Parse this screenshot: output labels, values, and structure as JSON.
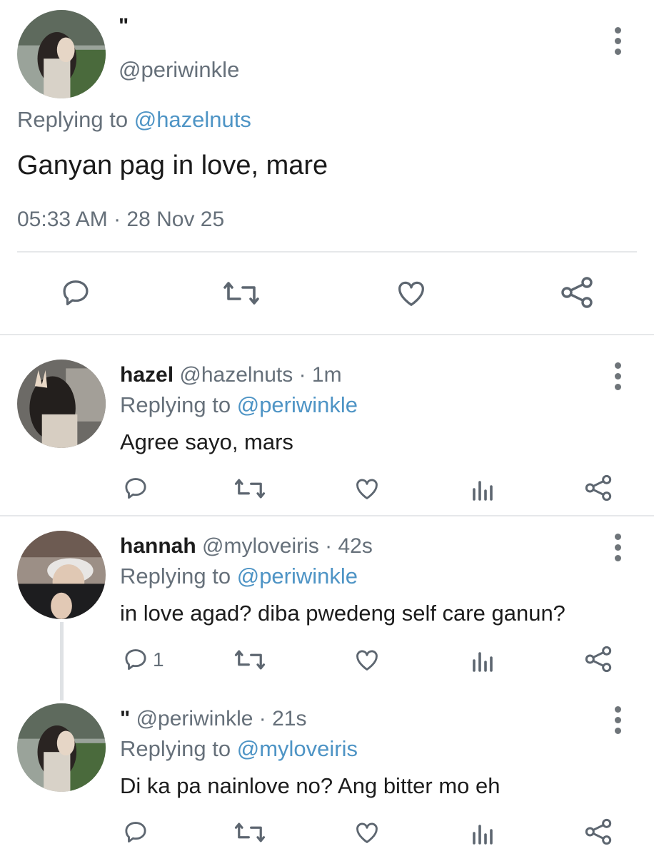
{
  "main_tweet": {
    "display_name": "\"",
    "handle": "@periwinkle",
    "replying_prefix": "Replying to",
    "replying_handle": "@hazelnuts",
    "text": "Ganyan pag in love, mare",
    "timestamp": "05:33 AM · 28 Nov 25",
    "actions": [
      "comment-icon",
      "retweet-icon",
      "heart-icon",
      "share-icon"
    ]
  },
  "replies": [
    {
      "name": "hazel",
      "handle": "@hazelnuts",
      "time": "· 1m",
      "replying_prefix": "Replying to",
      "replying_handle": "@periwinkle",
      "text": "Agree sayo, mars",
      "comment_count": ""
    },
    {
      "name": "hannah",
      "handle": "@myloveiris",
      "time": "· 42s",
      "replying_prefix": "Replying to",
      "replying_handle": "@periwinkle",
      "text": "in love agad? diba pwedeng self care ganun?",
      "comment_count": "1"
    },
    {
      "name": "\"",
      "handle": "@periwinkle",
      "time": "· 21s",
      "replying_prefix": "Replying to",
      "replying_handle": "@myloveiris",
      "text": "Di ka pa nainlove no? Ang bitter mo eh",
      "comment_count": ""
    }
  ],
  "colors": {
    "link": "#4e94c5",
    "secondary_text": "#66707a",
    "icon": "#5d6670",
    "divider": "#e6e8ea"
  }
}
